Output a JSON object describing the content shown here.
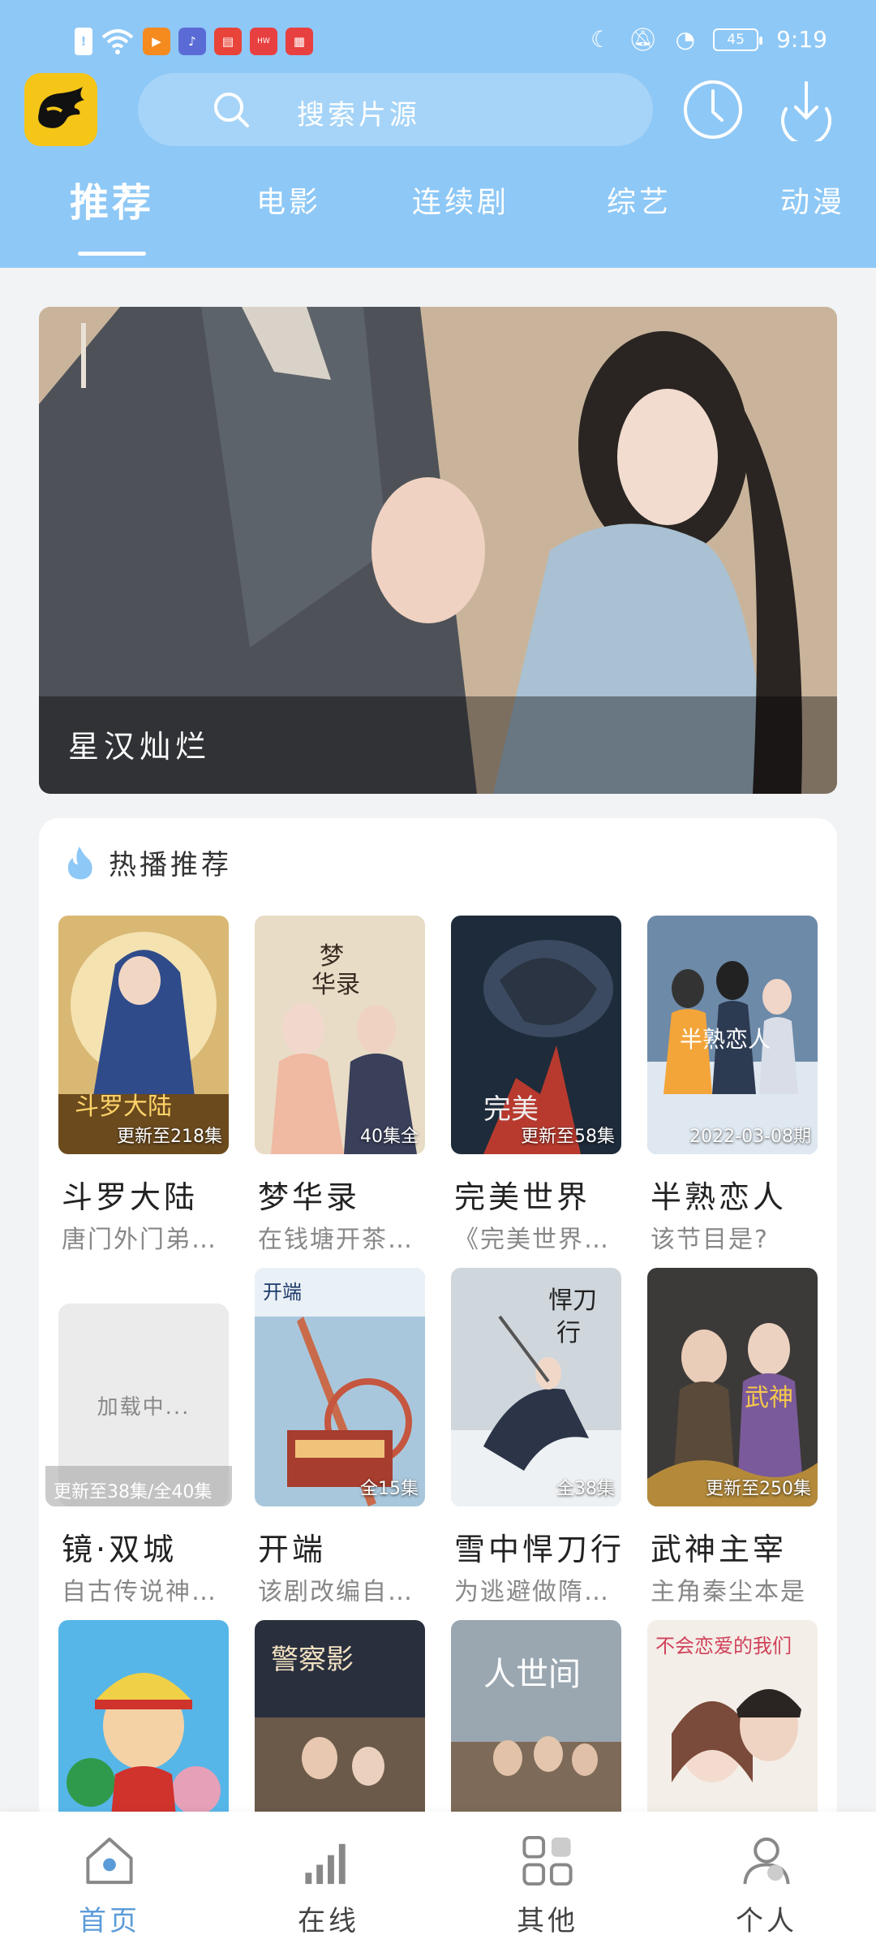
{
  "status_bar": {
    "time": "9:19",
    "battery": "45"
  },
  "search": {
    "placeholder": "搜索片源"
  },
  "tabs": [
    {
      "label": "推荐",
      "active": true
    },
    {
      "label": "电影"
    },
    {
      "label": "连续剧"
    },
    {
      "label": "综艺"
    },
    {
      "label": "动漫"
    }
  ],
  "banner": {
    "title": "星汉灿烂"
  },
  "hot": {
    "title": "热播推荐",
    "items": [
      {
        "title": "斗罗大陆",
        "desc": "唐门外门弟子唐三",
        "badge": "更新至218集"
      },
      {
        "title": "梦华录",
        "desc": "在钱塘开茶坊的赵盼儿",
        "badge": "40集全"
      },
      {
        "title": "完美世界",
        "desc": "《完美世界》讲述",
        "badge": "更新至58集"
      },
      {
        "title": "半熟恋人",
        "desc": "该节目是?",
        "badge": "2022-03-08期"
      },
      {
        "title": "镜·双城",
        "desc": "自古传说神秘的",
        "badge": "更新至38集/全40集",
        "loading_text": "加载中..."
      },
      {
        "title": "开端",
        "desc": "该剧改编自同名",
        "badge": "全15集"
      },
      {
        "title": "雪中悍刀行",
        "desc": "为逃避做隋珠公主",
        "badge": "全38集"
      },
      {
        "title": "武神主宰",
        "desc": "主角秦尘本是",
        "badge": "更新至250集"
      },
      {
        "title": "",
        "desc": "",
        "badge": ""
      },
      {
        "title": "",
        "desc": "",
        "badge": ""
      },
      {
        "title": "",
        "desc": "",
        "badge": ""
      },
      {
        "title": "",
        "desc": "",
        "badge": ""
      }
    ]
  },
  "bottom_nav": [
    {
      "label": "首页",
      "icon": "home-icon",
      "active": true
    },
    {
      "label": "在线",
      "icon": "bar-signal-icon"
    },
    {
      "label": "其他",
      "icon": "grid-icon"
    },
    {
      "label": "个人",
      "icon": "person-icon"
    }
  ],
  "colors": {
    "header": "#8ec8f6",
    "accent": "#5a9bd8",
    "logo": "#f5c518"
  }
}
